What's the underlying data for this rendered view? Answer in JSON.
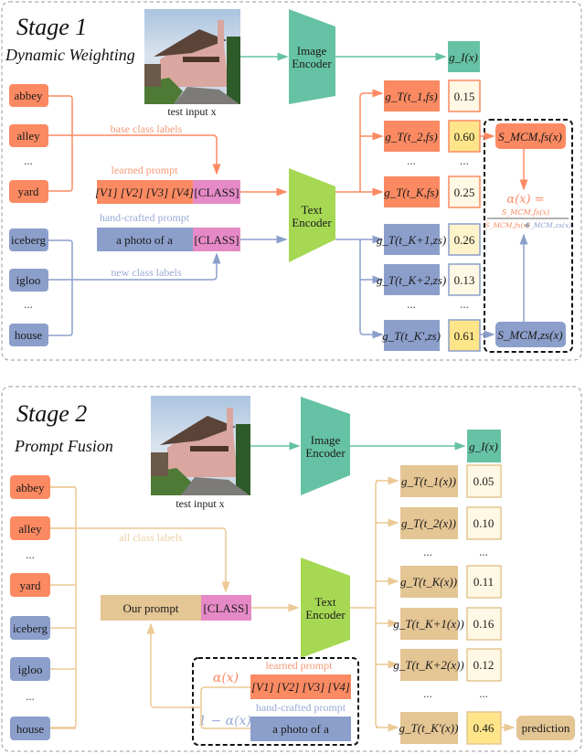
{
  "colors": {
    "orange": "#fb8a62",
    "blue": "#8c9fcb",
    "pink": "#e58ac6",
    "teal": "#66c2a5",
    "green": "#a6d854",
    "tan": "#e4c594",
    "score_light": "#fff8e4",
    "score_high": "#ffe58a",
    "line_tan": "#ecc994"
  },
  "stage1": {
    "title": "Stage 1",
    "subtitle": "Dynamic Weighting",
    "image_caption": "test input x",
    "image_encoder": [
      "Image",
      "Encoder"
    ],
    "text_encoder": [
      "Text",
      "Encoder"
    ],
    "image_feature": "g_I(x)",
    "base_classes": [
      "abbey",
      "alley",
      "...",
      "yard"
    ],
    "new_classes": [
      "iceberg",
      "igloo",
      "...",
      "house"
    ],
    "base_class_caption": "base class labels",
    "new_class_caption": "new class labels",
    "learned_prompt_caption": "learned prompt",
    "learned_prompt_tokens": "[V1] [V2] [V3] [V4]",
    "handcrafted_prompt_caption": "hand-crafted prompt",
    "handcrafted_prompt_text": "a photo of a",
    "class_token": "[CLASS]",
    "fs_features": [
      {
        "label": "g_T(t_1,fs)",
        "score": "0.15"
      },
      {
        "label": "g_T(t_2,fs)",
        "score": "0.60"
      },
      {
        "label": "...",
        "score": "..."
      },
      {
        "label": "g_T(t_K,fs)",
        "score": "0.25"
      }
    ],
    "zs_features": [
      {
        "label": "g_T(t_K+1,zs)",
        "score": "0.26"
      },
      {
        "label": "g_T(t_K+2,zs)",
        "score": "0.13"
      },
      {
        "label": "...",
        "score": "..."
      },
      {
        "label": "g_T(t_K',zs)",
        "score": "0.61"
      }
    ],
    "mcm_fs": "S_MCM,fs(x)",
    "mcm_zs": "S_MCM,zs(x)",
    "alpha_formula": {
      "lhs": "α(x) =",
      "numerator": "S_MCM,fs(x)",
      "denominator_fs": "S_MCM,fs(x)",
      "plus": "+",
      "denominator_zs": "S_MCM,zs(x)"
    }
  },
  "stage2": {
    "title": "Stage 2",
    "subtitle": "Prompt Fusion",
    "image_caption": "test input x",
    "image_encoder": [
      "Image",
      "Encoder"
    ],
    "text_encoder": [
      "Text",
      "Encoder"
    ],
    "image_feature": "g_I(x)",
    "classes": [
      {
        "name": "abbey",
        "kind": "base"
      },
      {
        "name": "alley",
        "kind": "base"
      },
      {
        "name": "...",
        "kind": "dots"
      },
      {
        "name": "yard",
        "kind": "base"
      },
      {
        "name": "iceberg",
        "kind": "new"
      },
      {
        "name": "igloo",
        "kind": "new"
      },
      {
        "name": "...",
        "kind": "dots"
      },
      {
        "name": "house",
        "kind": "new"
      }
    ],
    "all_class_caption": "all class labels",
    "our_prompt": "Our prompt",
    "class_token": "[CLASS]",
    "learned_prompt_caption": "learned prompt",
    "learned_prompt_tokens": "[V1] [V2] [V3] [V4]",
    "handcrafted_prompt_caption": "hand-crafted prompt",
    "handcrafted_prompt_text": "a photo of a",
    "alpha_weight": "α(x)",
    "one_minus_alpha_weight": "1 − α(x)",
    "features": [
      {
        "label": "g_T(t_1(x))",
        "score": "0.05"
      },
      {
        "label": "g_T(t_2(x))",
        "score": "0.10"
      },
      {
        "label": "...",
        "score": "..."
      },
      {
        "label": "g_T(t_K(x))",
        "score": "0.11"
      },
      {
        "label": "g_T(t_K+1(x))",
        "score": "0.16"
      },
      {
        "label": "g_T(t_K+2(x))",
        "score": "0.12"
      },
      {
        "label": "...",
        "score": "..."
      },
      {
        "label": "g_T(t_K'(x))",
        "score": "0.46"
      }
    ],
    "prediction": "prediction"
  }
}
